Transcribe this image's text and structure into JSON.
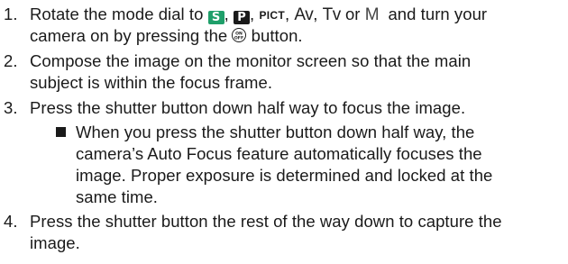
{
  "steps": [
    {
      "number": "1.",
      "line1_prefix": "Rotate the mode dial to",
      "line1_suffix": "and turn your",
      "modes": {
        "s": "S",
        "p": "P",
        "pict": "PICT",
        "av": "Av",
        "tv": "Tv",
        "m": "M",
        "sep": ",",
        "or": "or"
      },
      "line2_prefix": "camera on by pressing the",
      "power_icon_text": "ON\nOFF",
      "line2_suffix": "button."
    },
    {
      "number": "2.",
      "line1": "Compose the image on the monitor screen so that the main",
      "line2": "subject is within the focus frame."
    },
    {
      "number": "3.",
      "line1": "Press the shutter button down half way to focus the image.",
      "bullet": {
        "line1": "When you press the shutter button down half way, the",
        "line2": "camera’s Auto Focus feature automatically focuses the",
        "line3": "image. Proper exposure is determined and locked at the",
        "line4": "same time."
      }
    },
    {
      "number": "4.",
      "line1": "Press the shutter button the rest of the way down to capture the",
      "line2": "image."
    }
  ]
}
